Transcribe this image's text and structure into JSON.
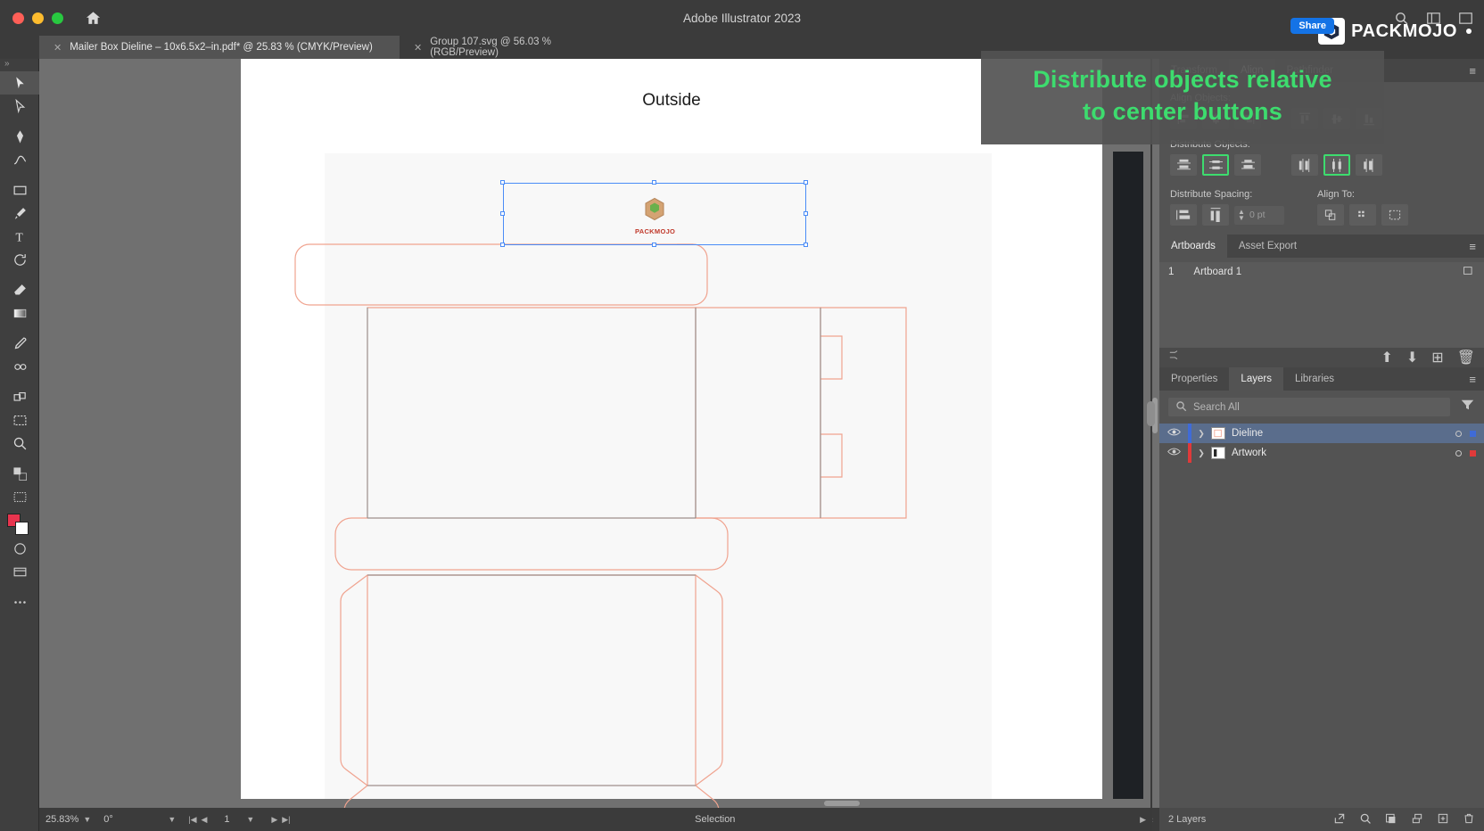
{
  "window": {
    "app_title": "Adobe Illustrator 2023",
    "traffic_lights": [
      "close",
      "minimize",
      "maximize"
    ],
    "share_label": "Share",
    "brand_name": "PACKMOJO"
  },
  "tabs": [
    {
      "label": "Mailer Box Dieline – 10x6.5x2–in.pdf* @ 25.83 % (CMYK/Preview)",
      "active": true
    },
    {
      "label": "Group 107.svg @ 56.03 % (RGB/Preview)",
      "active": false
    }
  ],
  "callout": {
    "line1": "Distribute objects relative",
    "line2": "to center buttons",
    "color": "#3ddc6e"
  },
  "canvas": {
    "artboard_label": "Outside",
    "logo_word": "PACKMOJO"
  },
  "toolbar": {
    "tools": [
      "selection-tool",
      "direct-selection-tool",
      "pen-tool",
      "curvature-tool",
      "rectangle-tool",
      "paintbrush-tool",
      "type-tool",
      "rotate-tool",
      "eraser-tool",
      "gradient-tool",
      "eyedropper-tool",
      "blend-tool",
      "shape-builder-tool",
      "artboard-tool",
      "zoom-tool",
      "hand-tool",
      "edit-toolbar"
    ]
  },
  "statusbar": {
    "zoom_level": "25.83%",
    "rotation": "0°",
    "artboard_number": "1",
    "tool_status": "Selection"
  },
  "align_panel": {
    "tabs": [
      {
        "label": "Transform",
        "active": false
      },
      {
        "label": "Align",
        "active": true
      },
      {
        "label": "Pathfinder",
        "active": false
      }
    ],
    "align_objects_label": "Align Objects:",
    "distribute_objects_label": "Distribute Objects:",
    "distribute_spacing_label": "Distribute Spacing:",
    "align_to_label": "Align To:",
    "spacing_value": "0 pt",
    "distribute_vertical_buttons": [
      {
        "name": "vertical-align-top",
        "highlighted": false
      },
      {
        "name": "vertical-distribute-center",
        "highlighted": true
      },
      {
        "name": "vertical-align-bottom",
        "highlighted": false
      }
    ],
    "distribute_horizontal_buttons": [
      {
        "name": "horizontal-align-left",
        "highlighted": false
      },
      {
        "name": "horizontal-distribute-center",
        "highlighted": true
      },
      {
        "name": "horizontal-align-right",
        "highlighted": false
      }
    ]
  },
  "artboards_panel": {
    "tabs": [
      {
        "label": "Artboards",
        "active": true
      },
      {
        "label": "Asset Export",
        "active": false
      }
    ],
    "rows": [
      {
        "index": "1",
        "name": "Artboard 1"
      }
    ]
  },
  "layers_panel": {
    "tabs": [
      {
        "label": "Properties",
        "active": false
      },
      {
        "label": "Layers",
        "active": true
      },
      {
        "label": "Libraries",
        "active": false
      }
    ],
    "search_placeholder": "Search All",
    "layers": [
      {
        "name": "Dieline",
        "color": "#f08a7a",
        "selected": true,
        "visible": true
      },
      {
        "name": "Artwork",
        "color": "#e03a3a",
        "selected": false,
        "visible": true
      }
    ],
    "footer_count": "2 Layers"
  }
}
